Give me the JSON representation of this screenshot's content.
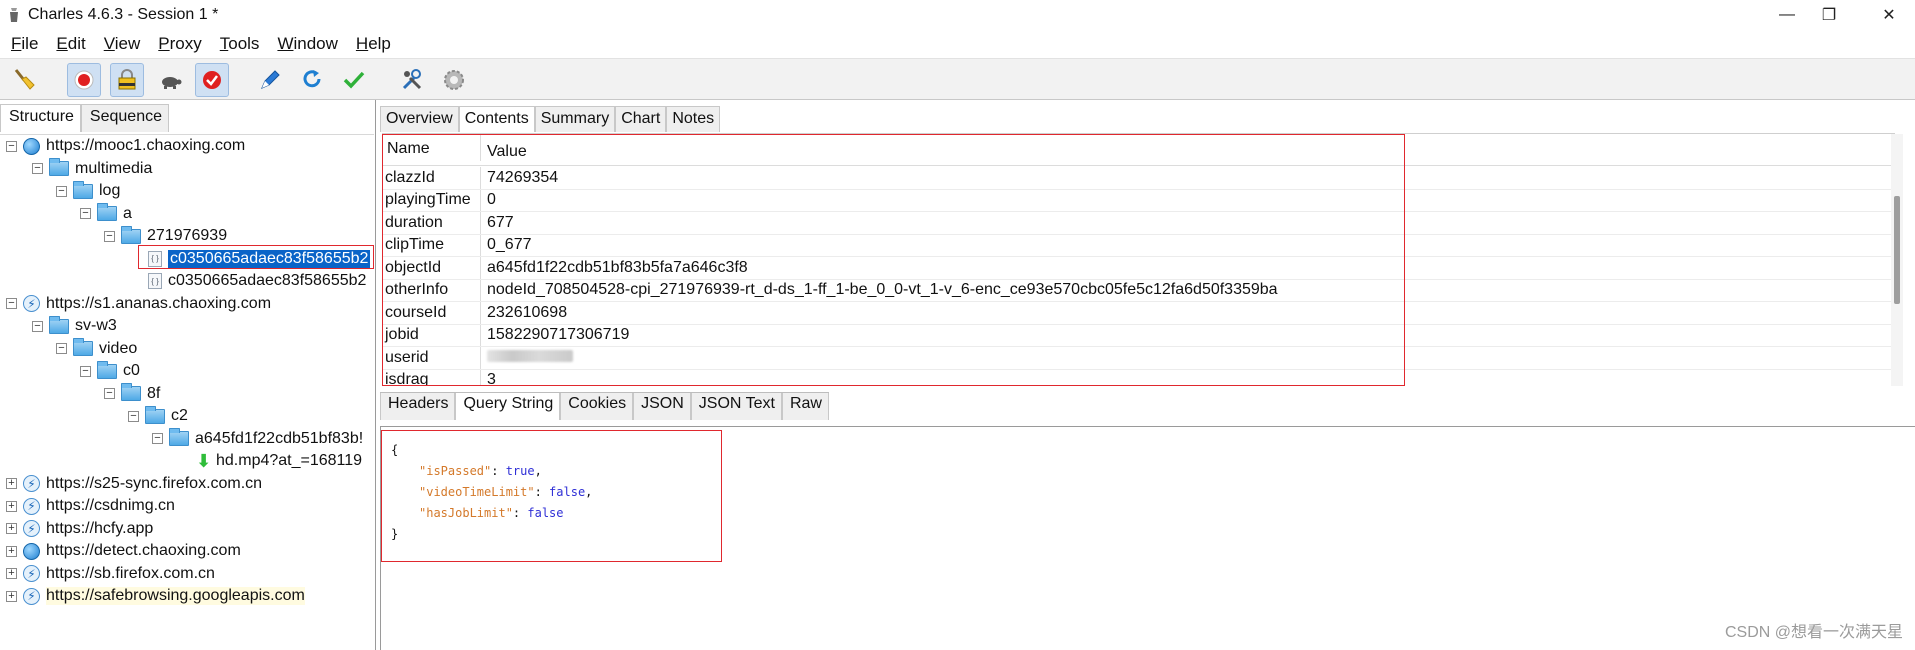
{
  "window": {
    "title": "Charles 4.6.3 - Session 1 *",
    "min": "—",
    "max": "❐",
    "close": "✕"
  },
  "menu": [
    {
      "label": "File",
      "key": "F",
      "rest": "ile"
    },
    {
      "label": "Edit",
      "key": "E",
      "rest": "dit"
    },
    {
      "label": "View",
      "key": "V",
      "rest": "iew"
    },
    {
      "label": "Proxy",
      "key": "P",
      "rest": "roxy"
    },
    {
      "label": "Tools",
      "key": "T",
      "rest": "ools"
    },
    {
      "label": "Window",
      "key": "W",
      "rest": "indow"
    },
    {
      "label": "Help",
      "key": "H",
      "rest": "elp"
    }
  ],
  "left_tabs": {
    "structure": "Structure",
    "sequence": "Sequence"
  },
  "tree": {
    "host1": "https://mooc1.chaoxing.com",
    "multimedia": "multimedia",
    "log": "log",
    "a": "a",
    "num": "271976939",
    "file1": "c0350665adaec83f58655b2",
    "file2": "c0350665adaec83f58655b2",
    "host2": "https://s1.ananas.chaoxing.com",
    "svw3": "sv-w3",
    "video": "video",
    "c0": "c0",
    "f8": "8f",
    "c2": "c2",
    "hash": "a645fd1f22cdb51bf83b!",
    "mp4": "hd.mp4?at_=168119",
    "host3": "https://s25-sync.firefox.com.cn",
    "host4": "https://csdnimg.cn",
    "host5": "https://hcfy.app",
    "host6": "https://detect.chaoxing.com",
    "host7": "https://sb.firefox.com.cn",
    "host8": "https://safebrowsing.googleapis.com"
  },
  "top_tabs": [
    "Overview",
    "Contents",
    "Summary",
    "Chart",
    "Notes"
  ],
  "table": {
    "col_name": "Name",
    "col_value": "Value",
    "rows": [
      {
        "name": "clazzId",
        "value": "74269354"
      },
      {
        "name": "playingTime",
        "value": "0"
      },
      {
        "name": "duration",
        "value": "677"
      },
      {
        "name": "clipTime",
        "value": "0_677"
      },
      {
        "name": "objectId",
        "value": "a645fd1f22cdb51bf83b5fa7a646c3f8"
      },
      {
        "name": "otherInfo",
        "value": "nodeId_708504528-cpi_271976939-rt_d-ds_1-ff_1-be_0_0-vt_1-v_6-enc_ce93e570cbc05fe5c12fa6d50f3359ba"
      },
      {
        "name": "courseId",
        "value": "232610698"
      },
      {
        "name": "jobid",
        "value": "1582290717306719"
      },
      {
        "name": "userid",
        "value": ""
      },
      {
        "name": "isdrag",
        "value": "3"
      }
    ]
  },
  "bottom_tabs": [
    "Headers",
    "Query String",
    "Cookies",
    "JSON",
    "JSON Text",
    "Raw"
  ],
  "json": {
    "open": "{",
    "k1": "\"isPassed\"",
    "v1": "true",
    "k2": "\"videoTimeLimit\"",
    "v2": "false",
    "k3": "\"hasJobLimit\"",
    "v3": "false",
    "close": "}"
  },
  "watermark": "CSDN @想看一次满天星",
  "colors": {
    "selection": "#0a64c8",
    "annotation_red": "#e0282e",
    "json_key": "#d4792a",
    "json_value": "#2f2fd6"
  }
}
